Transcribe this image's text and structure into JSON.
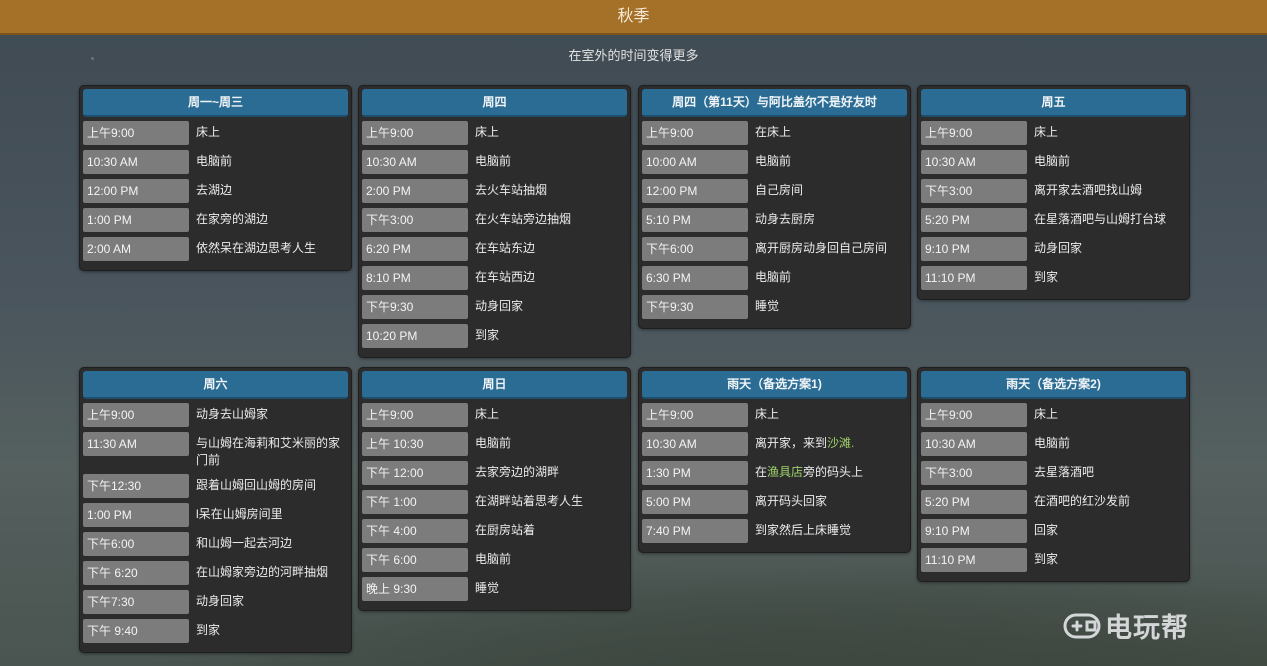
{
  "header": {
    "title": "秋季",
    "subtitle": "在室外的时间变得更多"
  },
  "cards": [
    {
      "title": "周一~周三",
      "rows": [
        {
          "time": "上午9:00",
          "activity": "床上"
        },
        {
          "time": "10:30 AM",
          "activity": "电脑前"
        },
        {
          "time": "12:00 PM",
          "activity": "去湖边"
        },
        {
          "time": "1:00 PM",
          "activity": "在家旁的湖边"
        },
        {
          "time": "2:00 AM",
          "activity": "依然呆在湖边思考人生"
        }
      ]
    },
    {
      "title": "周四",
      "rows": [
        {
          "time": "上午9:00",
          "activity": "床上"
        },
        {
          "time": "10:30 AM",
          "activity": "电脑前"
        },
        {
          "time": "2:00 PM",
          "activity": "去火车站抽烟"
        },
        {
          "time": "下午3:00",
          "activity": "在火车站旁边抽烟"
        },
        {
          "time": "6:20 PM",
          "activity": "在车站东边"
        },
        {
          "time": "8:10 PM",
          "activity": "在车站西边"
        },
        {
          "time": "下午9:30",
          "activity": "动身回家"
        },
        {
          "time": "10:20 PM",
          "activity": "到家"
        }
      ]
    },
    {
      "title": "周四（第11天）与阿比盖尔不是好友时",
      "rows": [
        {
          "time": "上午9:00",
          "activity": "在床上"
        },
        {
          "time": "10:00 AM",
          "activity": "电脑前"
        },
        {
          "time": "12:00 PM",
          "activity": "自己房间"
        },
        {
          "time": "5:10 PM",
          "activity": "动身去厨房"
        },
        {
          "time": "下午6:00",
          "activity": "离开厨房动身回自己房间"
        },
        {
          "time": "6:30 PM",
          "activity": "电脑前"
        },
        {
          "time": "下午9:30",
          "activity": "睡觉"
        }
      ]
    },
    {
      "title": "周五",
      "rows": [
        {
          "time": "上午9:00",
          "activity": "床上"
        },
        {
          "time": "10:30 AM",
          "activity": "电脑前"
        },
        {
          "time": "下午3:00",
          "activity": "离开家去酒吧找山姆"
        },
        {
          "time": "5:20 PM",
          "activity": "在星落酒吧与山姆打台球"
        },
        {
          "time": "9:10 PM",
          "activity": "动身回家"
        },
        {
          "time": "11:10 PM",
          "activity": "到家"
        }
      ]
    },
    {
      "title": "周六",
      "rows": [
        {
          "time": "上午9:00",
          "activity": "动身去山姆家"
        },
        {
          "time": "11:30 AM",
          "activity": "与山姆在海莉和艾米丽的家门前"
        },
        {
          "time": "下午12:30",
          "activity": "跟着山姆回山姆的房间"
        },
        {
          "time": "1:00 PM",
          "activity": "l呆在山姆房间里"
        },
        {
          "time": "下午6:00",
          "activity": "和山姆一起去河边"
        },
        {
          "time": "下午 6:20",
          "activity": "在山姆家旁边的河畔抽烟"
        },
        {
          "time": "下午7:30",
          "activity": "动身回家"
        },
        {
          "time": "下午 9:40",
          "activity": "到家"
        }
      ]
    },
    {
      "title": "周日",
      "rows": [
        {
          "time": "上午9:00",
          "activity": "床上"
        },
        {
          "time": "上午 10:30",
          "activity": "电脑前"
        },
        {
          "time": "下午 12:00",
          "activity": "去家旁边的湖畔"
        },
        {
          "time": "下午 1:00",
          "activity": "在湖畔站着思考人生"
        },
        {
          "time": "下午 4:00",
          "activity": "在厨房站着"
        },
        {
          "time": "下午 6:00",
          "activity": "电脑前"
        },
        {
          "time": "晚上 9:30",
          "activity": "睡觉"
        }
      ]
    },
    {
      "title": "雨天（备选方案1)",
      "rows": [
        {
          "time": "上午9:00",
          "activity": "床上"
        },
        {
          "time": "10:30 AM",
          "activity_pre": "离开家，来到",
          "activity_link": "沙滩.",
          "activity_post": ""
        },
        {
          "time": "1:30 PM",
          "activity_pre": "在",
          "activity_link": "渔具店",
          "activity_post": "旁的码头上"
        },
        {
          "time": "5:00 PM",
          "activity": "离开码头回家"
        },
        {
          "time": "7:40 PM",
          "activity": "到家然后上床睡觉"
        }
      ]
    },
    {
      "title": "雨天（备选方案2)",
      "rows": [
        {
          "time": "上午9:00",
          "activity": "床上"
        },
        {
          "time": "10:30 AM",
          "activity": "电脑前"
        },
        {
          "time": "下午3:00",
          "activity": "去星落酒吧"
        },
        {
          "time": "5:20 PM",
          "activity": "在酒吧的红沙发前"
        },
        {
          "time": "9:10 PM",
          "activity": "回家"
        },
        {
          "time": "11:10 PM",
          "activity": "到家"
        }
      ]
    }
  ],
  "watermark": {
    "text": "电玩帮"
  }
}
